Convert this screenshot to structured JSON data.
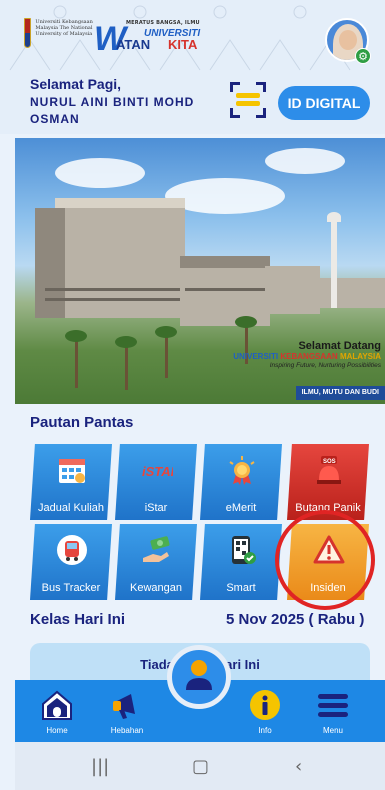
{
  "header": {
    "ukm_logo_text": "Universiti Kebangsaan Malaysia The National University of Malaysia",
    "vk_top_text": "MERATUS BANGSA, ILMU",
    "vk_uni": "UNIVERSITI",
    "vk_atan": "ATAN",
    "vk_kita": "KITA"
  },
  "greeting": {
    "label": "Selamat Pagi,",
    "name": "NURUL AINI BINTI MOHD OSMAN",
    "id_button": "ID DIGITAL"
  },
  "banner": {
    "welcome": "Selamat Datang",
    "uni_1": "UNIVERSITI",
    "uni_2": "KEBANGSAAN",
    "uni_3": "MALAYSIA",
    "tagline": "Inspiring Future, Nurturing Possibilities",
    "motto": "ILMU, MUTU DAN BUDI"
  },
  "quick_links": {
    "title": "Pautan Pantas",
    "items": [
      {
        "label": "Jadual Kuliah",
        "icon": "calendar-icon"
      },
      {
        "label": "iStar",
        "icon": "istar-logo"
      },
      {
        "label": "eMerit",
        "icon": "medal-icon"
      },
      {
        "label": "Butang Panik",
        "icon": "sos-icon"
      },
      {
        "label": "Bus Tracker",
        "icon": "bus-icon"
      },
      {
        "label": "Kewangan",
        "icon": "money-icon"
      },
      {
        "label": "Smart",
        "icon": "qr-phone-icon"
      },
      {
        "label": "Insiden",
        "icon": "warning-icon"
      }
    ]
  },
  "classes": {
    "title": "Kelas Hari Ini",
    "date": "5 Nov 2025 ( Rabu )",
    "empty_text": "Tiada Kelas Hari Ini"
  },
  "bottom_nav": {
    "home": "Home",
    "news": "Hebahan",
    "info": "Info",
    "menu": "Menu"
  },
  "colors": {
    "primary": "#1e88e5",
    "heading": "#1a237e",
    "tile_blue": "#2d8de9",
    "tile_red": "#e6463e",
    "tile_orange": "#f7b544",
    "highlight": "#e02424"
  }
}
